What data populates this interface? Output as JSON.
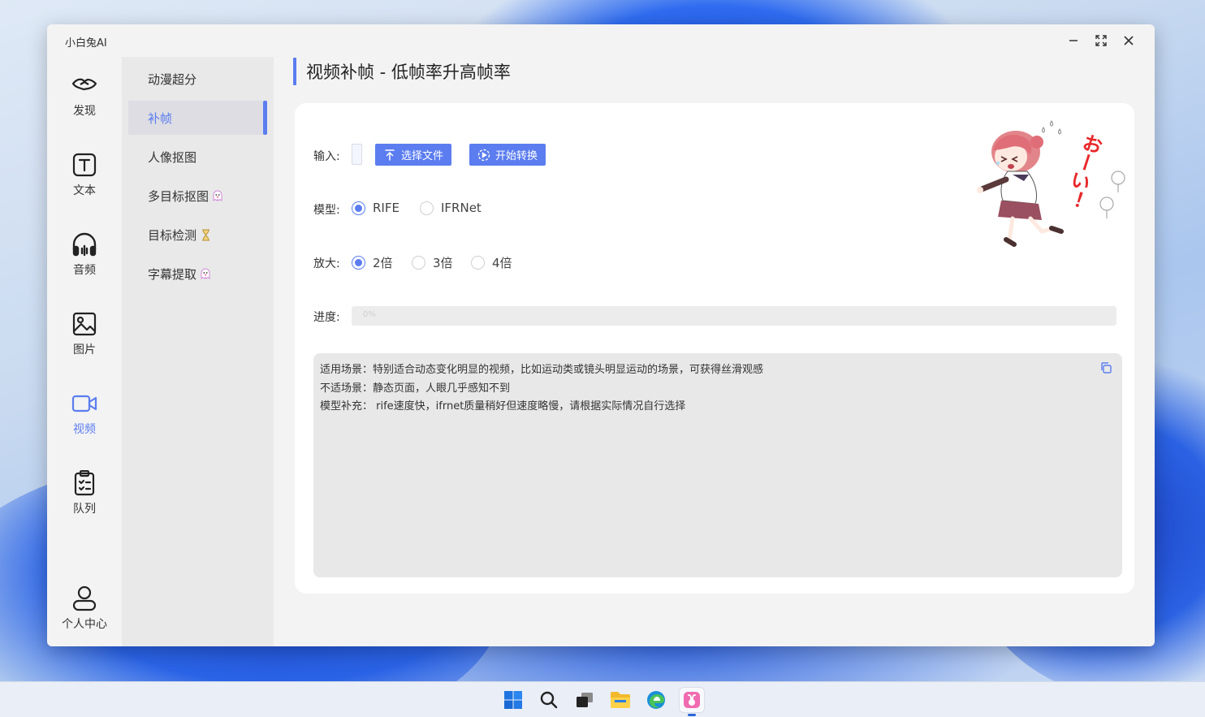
{
  "app": {
    "title": "小白兔AI"
  },
  "nav": [
    {
      "id": "discover",
      "label": "发现",
      "icon": "handshake-icon"
    },
    {
      "id": "text",
      "label": "文本",
      "icon": "text-icon"
    },
    {
      "id": "audio",
      "label": "音频",
      "icon": "headphones-icon"
    },
    {
      "id": "image",
      "label": "图片",
      "icon": "image-icon"
    },
    {
      "id": "video",
      "label": "视频",
      "icon": "video-icon",
      "active": true
    },
    {
      "id": "queue",
      "label": "队列",
      "icon": "clipboard-icon"
    },
    {
      "id": "profile",
      "label": "个人中心",
      "icon": "user-icon"
    }
  ],
  "submenu": [
    {
      "label": "动漫超分"
    },
    {
      "label": "补帧",
      "active": true
    },
    {
      "label": "人像抠图"
    },
    {
      "label": "多目标抠图",
      "badge": "ghost-icon"
    },
    {
      "label": "目标检测",
      "badge": "hourglass-icon"
    },
    {
      "label": "字幕提取",
      "badge": "ghost-icon"
    }
  ],
  "page": {
    "title": "视频补帧 - 低帧率升高帧率"
  },
  "form": {
    "input_label": "输入:",
    "select_file": "选择文件",
    "start_convert": "开始转换",
    "model_label": "模型:",
    "models": [
      {
        "label": "RIFE",
        "checked": true
      },
      {
        "label": "IFRNet",
        "checked": false
      }
    ],
    "scale_label": "放大:",
    "scales": [
      {
        "label": "2倍",
        "checked": true
      },
      {
        "label": "3倍",
        "checked": false
      },
      {
        "label": "4倍",
        "checked": false
      }
    ],
    "progress_label": "进度:",
    "progress_value": 0,
    "progress_text": "0%"
  },
  "notes": [
    "适用场景：特别适合动态变化明显的视频，比如运动类或镜头明显运动的场景，可获得丝滑观感",
    "不适场景：静态页面，人眼几乎感知不到",
    "模型补充：  rife速度快，ifrnet质量稍好但速度略慢，请根据实际情况自行选择"
  ],
  "mascot_caption": "おーい！",
  "colors": {
    "accent": "#5b7df0",
    "window_bg": "#f3f3f3",
    "submenu_bg": "#e9e9e9",
    "notes_bg": "#e8e8e8"
  },
  "taskbar": [
    {
      "icon": "windows-start-icon"
    },
    {
      "icon": "search-icon"
    },
    {
      "icon": "task-view-icon"
    },
    {
      "icon": "file-explorer-icon"
    },
    {
      "icon": "edge-browser-icon"
    },
    {
      "icon": "xiaobaitu-app-icon",
      "active": true
    }
  ]
}
